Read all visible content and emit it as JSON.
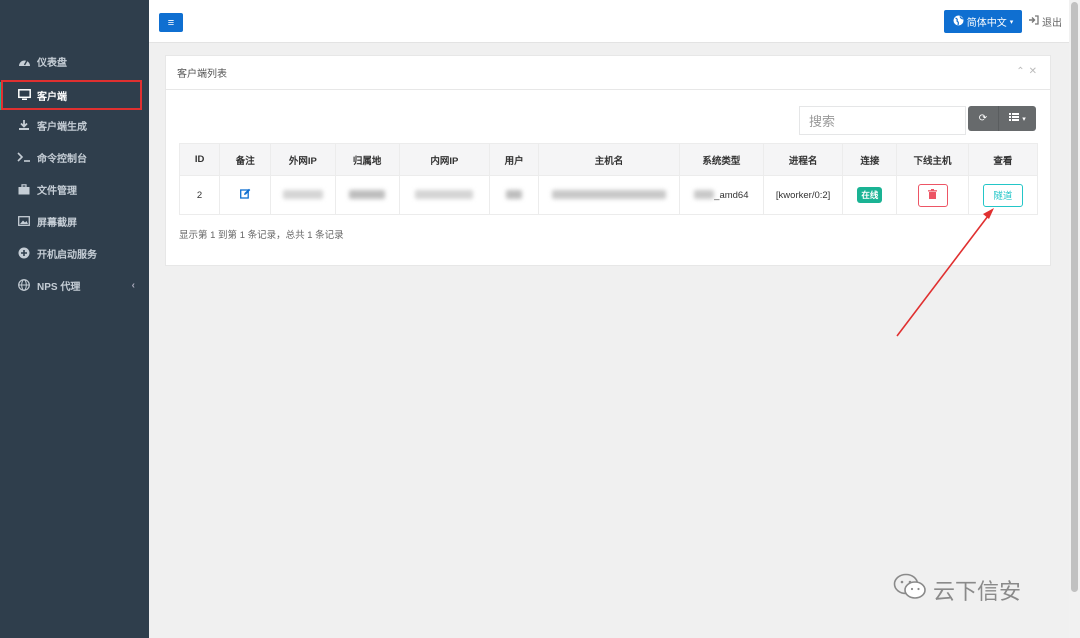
{
  "sidebar": {
    "items": [
      {
        "label": "仪表盘",
        "icon": "dashboard-icon"
      },
      {
        "label": "客户端",
        "icon": "monitor-icon",
        "active": true
      },
      {
        "label": "客户端生成",
        "icon": "download-icon"
      },
      {
        "label": "命令控制台",
        "icon": "terminal-icon"
      },
      {
        "label": "文件管理",
        "icon": "briefcase-icon"
      },
      {
        "label": "屏幕截屏",
        "icon": "image-icon"
      },
      {
        "label": "开机启动服务",
        "icon": "plus-circle-icon"
      },
      {
        "label": "NPS 代理",
        "icon": "globe-icon"
      }
    ]
  },
  "header": {
    "language_label": "简体中文",
    "logout_label": "退出"
  },
  "panel": {
    "title": "客户端列表",
    "search_placeholder": "搜索",
    "columns": [
      "ID",
      "备注",
      "外网IP",
      "归属地",
      "内网IP",
      "用户",
      "主机名",
      "系统类型",
      "进程名",
      "连接",
      "下线主机",
      "查看"
    ],
    "rows": [
      {
        "id": "2",
        "os_type_suffix": "_amd64",
        "process": "[kworker/0:2]",
        "status": "在线",
        "view_label": "隧道"
      }
    ],
    "summary": "显示第 1 到第 1 条记录，总共 1 条记录"
  },
  "colors": {
    "sidebar_bg": "#2f3e4c",
    "primary": "#0f6fd1",
    "online_badge": "#1ab394",
    "danger": "#ed5565",
    "info": "#23c6c8",
    "annotation_red": "#e03030"
  },
  "watermark": {
    "text": "云下信安"
  }
}
